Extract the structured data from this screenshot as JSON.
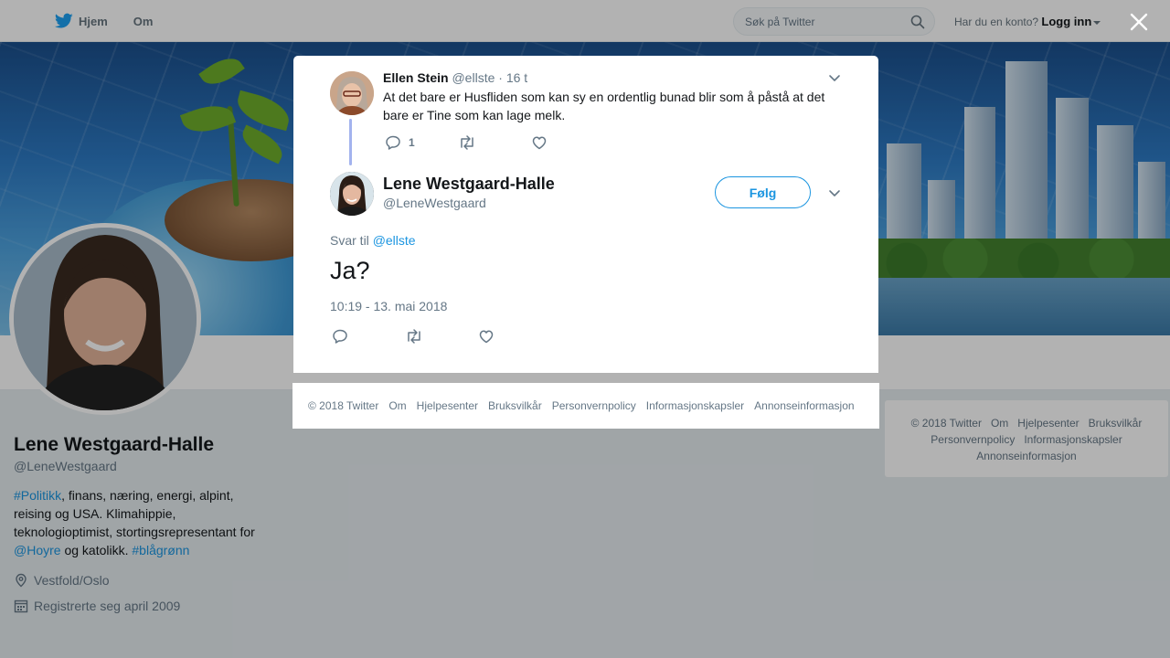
{
  "topbar": {
    "nav": [
      {
        "label": "Hjem",
        "icon": "twitter-bird-icon"
      },
      {
        "label": "Om"
      }
    ],
    "search": {
      "placeholder": "Søk på Twitter",
      "value": ""
    },
    "account_prompt": "Har du en konto?",
    "login_label": "Logg inn"
  },
  "profile": {
    "name": "Lene Westgaard-Halle",
    "handle": "@LeneWestgaard",
    "bio": {
      "hashtag1": "#Politikk",
      "text1": ", finans, næring, energi, alpint, reising og USA. Klimahippie, teknologioptimist, stortingsrepresentant for ",
      "mention": "@Hoyre",
      "text2": " og katolikk. ",
      "hashtag2": "#blågrønn"
    },
    "location": "Vestfold/Oslo",
    "joined": "Registrerte seg april 2009"
  },
  "sidebar_footer": [
    "© 2018 Twitter",
    "Om",
    "Hjelpesenter",
    "Bruksvilkår",
    "Personvernpolicy",
    "Informasjonskapsler",
    "Annonseinformasjon"
  ],
  "modal": {
    "ancestor": {
      "name": "Ellen Stein",
      "handle": "@ellste",
      "time": "16 t",
      "text": "At det bare er Husfliden som kan sy en ordentlig bunad blir som å påstå at det bare er Tine som kan lage melk.",
      "reply_count": "1"
    },
    "tweet": {
      "name": "Lene Westgaard-Halle",
      "handle": "@LeneWestgaard",
      "follow_label": "Følg",
      "reply_prefix": "Svar til",
      "reply_to": "@ellste",
      "text": "Ja?",
      "timestamp": "10:19 - 13. mai 2018"
    },
    "footer": [
      "© 2018 Twitter",
      "Om",
      "Hjelpesenter",
      "Bruksvilkår",
      "Personvernpolicy",
      "Informasjonskapsler",
      "Annonseinformasjon"
    ]
  },
  "colors": {
    "link": "#1b95e0",
    "thread_line": "#a3b3ee",
    "overlay": "rgba(0,0,0,0.30)"
  }
}
